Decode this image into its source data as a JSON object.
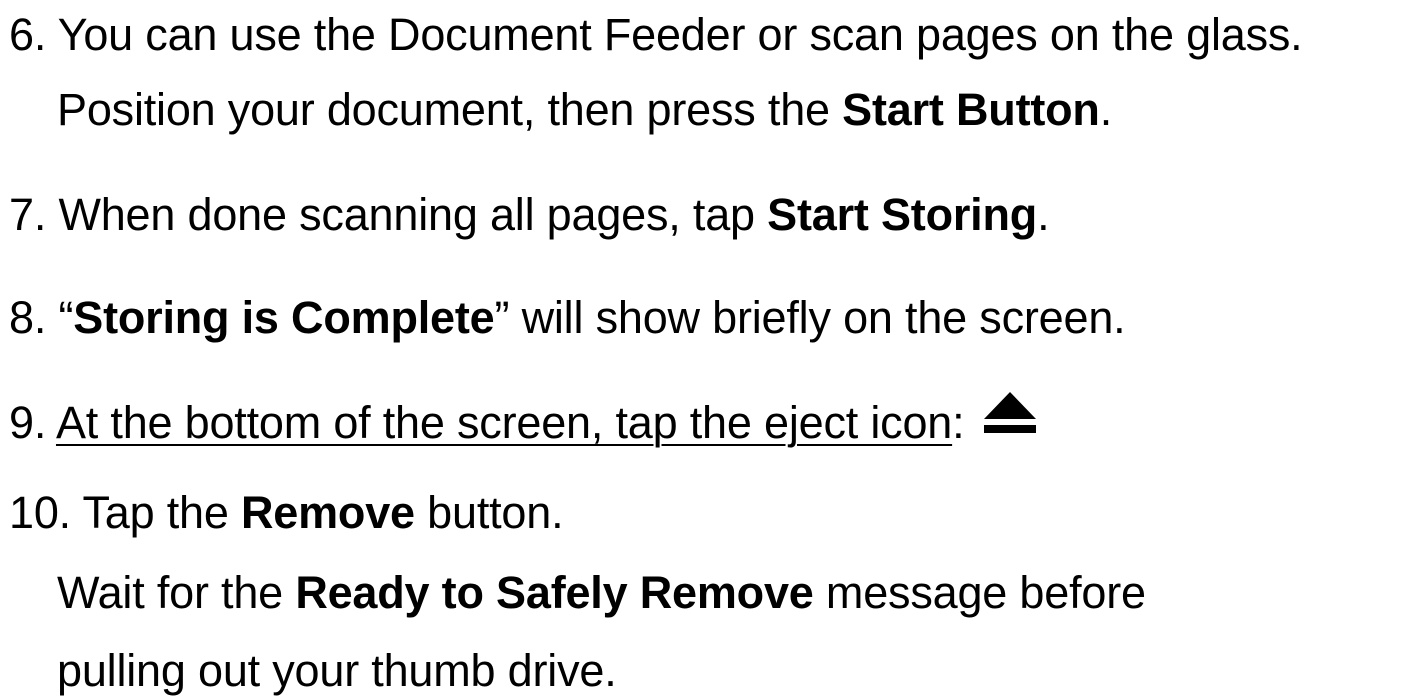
{
  "steps": {
    "s6": {
      "num": "6.",
      "line1": "You can use the Document Feeder or scan pages on the glass.",
      "line2_pre": "Position your document, then press the ",
      "line2_bold": "Start Button",
      "line2_post": "."
    },
    "s7": {
      "num": "7.",
      "pre": "When done scanning all pages, tap ",
      "bold": "Start Storing",
      "post": "."
    },
    "s8": {
      "num": "8.",
      "open_quote": "“",
      "bold": "Storing is Complete",
      "post": "” will show briefly on the screen."
    },
    "s9": {
      "num": "9.",
      "underlined": "At the bottom of the screen, tap the eject icon",
      "post": ":",
      "icon": "eject-icon"
    },
    "s10": {
      "num": "10.",
      "pre": "Tap the ",
      "bold": "Remove",
      "post": " button.",
      "line2_pre": "Wait for the ",
      "line2_bold": "Ready to Safely Remove",
      "line2_post": " message before",
      "line3": "pulling out your thumb drive."
    }
  }
}
